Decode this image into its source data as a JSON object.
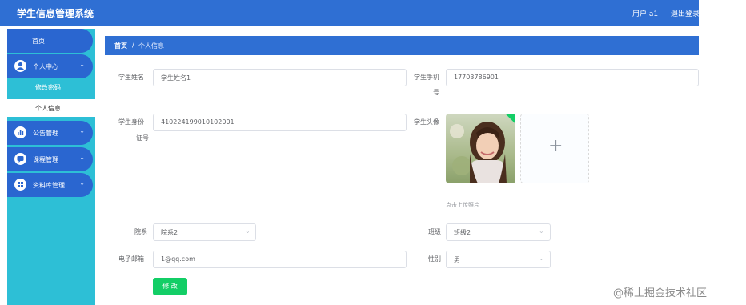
{
  "header": {
    "app_title": "学生信息管理系统",
    "user_label": "用户 a1",
    "logout_label": "退出登录"
  },
  "sidebar": {
    "home": "首页",
    "personal_center": {
      "label": "个人中心",
      "icon": "person-icon",
      "items": [
        "修改密码",
        "个人信息"
      ]
    },
    "menus": [
      {
        "label": "公告管理",
        "icon": "chart-icon"
      },
      {
        "label": "课程管理",
        "icon": "message-icon"
      },
      {
        "label": "资料库管理",
        "icon": "grid-icon"
      }
    ]
  },
  "breadcrumb": {
    "home": "首页",
    "separator": "/",
    "current": "个人信息"
  },
  "form": {
    "name": {
      "label": "学生姓名",
      "value": "学生姓名1"
    },
    "phone": {
      "label_line1": "学生手机",
      "label_line2": "号",
      "value": "17703786901"
    },
    "id_card": {
      "label_line1": "学生身份",
      "label_line2": "证号",
      "value": "410224199010102001"
    },
    "avatar": {
      "label": "学生头像",
      "upload_tip": "点击上传照片"
    },
    "department": {
      "label": "院系",
      "value": "院系2"
    },
    "class": {
      "label": "班级",
      "value": "班级2"
    },
    "email": {
      "label": "电子邮箱",
      "value": "1@qq.com"
    },
    "gender": {
      "label": "性别",
      "value": "男"
    },
    "submit_label": "修 改"
  },
  "watermark": "@稀土掘金技术社区",
  "colors": {
    "header_blue": "#2f6fd3",
    "sidebar_cyan": "#2dbfd6",
    "button_green": "#13ce66"
  }
}
